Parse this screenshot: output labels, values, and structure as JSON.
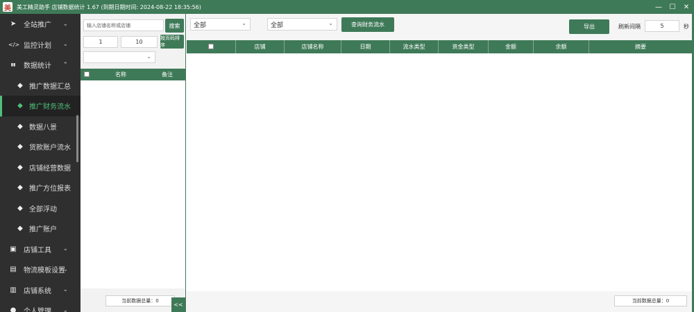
{
  "window": {
    "title": "美工精灵助手 店铺数据统计 1.67 (到期日期时间: 2024-08-22 18:35:56)",
    "logo": "美",
    "controls": [
      "—",
      "☐",
      "✕"
    ]
  },
  "sidebar": {
    "items": [
      {
        "label": "全站推广",
        "icon": "send-icon",
        "glyph": "➤"
      },
      {
        "label": "监控计划",
        "icon": "code-icon",
        "glyph": "</>"
      },
      {
        "label": "数据统计",
        "icon": "bar-chart-icon",
        "glyph": "▮▮"
      }
    ],
    "subitems": [
      {
        "label": "推广数据汇总"
      },
      {
        "label": "推广财务流水"
      },
      {
        "label": "数据八景"
      },
      {
        "label": "货款账户流水"
      },
      {
        "label": "店铺经营数据"
      },
      {
        "label": "推广方位报表"
      },
      {
        "label": "全部浮动"
      },
      {
        "label": "推广账户"
      }
    ],
    "bottom_items": [
      {
        "label": "店铺工具",
        "icon": "user-card-icon",
        "glyph": "▣"
      },
      {
        "label": "物流模板设置",
        "icon": "briefcase-icon",
        "glyph": "▤"
      },
      {
        "label": "店铺系统",
        "icon": "bank-icon",
        "glyph": "▥"
      },
      {
        "label": "个人管理",
        "icon": "user-icon",
        "glyph": "●"
      }
    ]
  },
  "mid": {
    "search_placeholder": "输入店铺名称或店铺",
    "search_button": "搜索",
    "page_from": "1",
    "page_to": "10",
    "page_button": "按页码排序",
    "dropdown_value": "",
    "table_headers": [
      "名称",
      "备注"
    ],
    "footer": "当前数据总量：0",
    "collapse": "<<"
  },
  "main": {
    "filter1": "全部",
    "filter2": "全部",
    "query_button": "查询财务流水",
    "export_button": "导出",
    "interval_label": "刷新间隔",
    "interval_value": "5",
    "interval_unit": "秒",
    "table_headers": [
      "店铺",
      "店铺名称",
      "日期",
      "流水类型",
      "资金类型",
      "金额",
      "余额",
      "摘要"
    ],
    "footer": "当前数据总量：0"
  }
}
